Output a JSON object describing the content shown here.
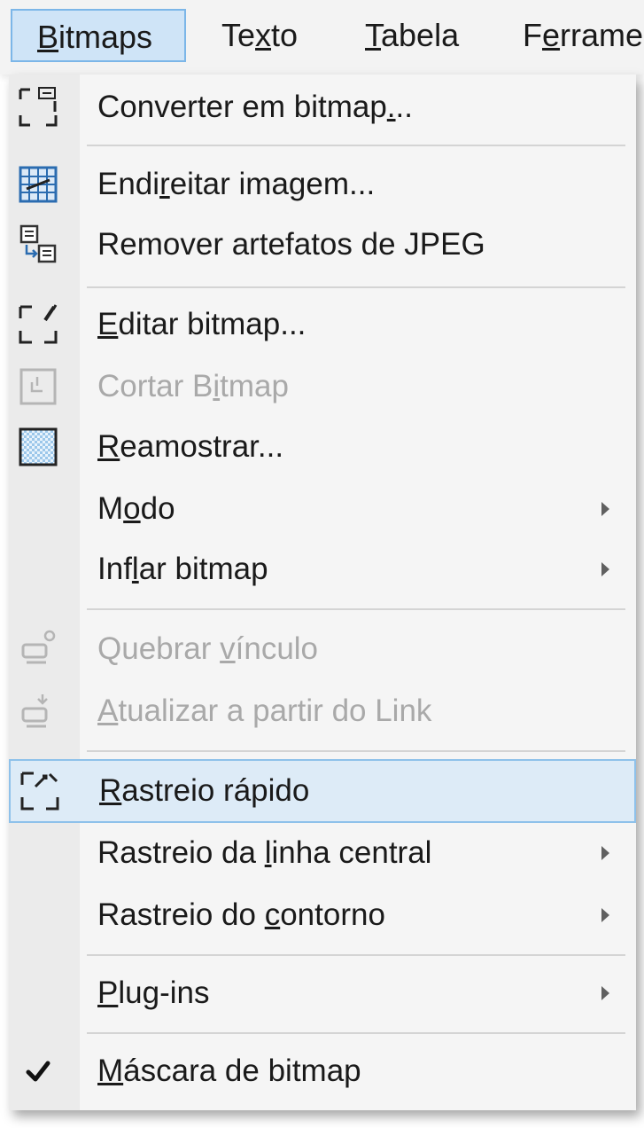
{
  "menubar": {
    "items": [
      {
        "pre": "",
        "key": "B",
        "post": "itmaps"
      },
      {
        "pre": "Te",
        "key": "x",
        "post": "to"
      },
      {
        "pre": "",
        "key": "T",
        "post": "abela"
      },
      {
        "pre": "F",
        "key": "e",
        "post": "rrame"
      }
    ]
  },
  "menu": {
    "items": [
      {
        "pre": "Converter em bitmap",
        "key": ".",
        "post": ".."
      },
      {
        "pre": "Endi",
        "key": "r",
        "post": "eitar imagem..."
      },
      {
        "pre": "Remover artefatos de JPEG",
        "key": "",
        "post": ""
      },
      {
        "pre": "",
        "key": "E",
        "post": "ditar bitmap..."
      },
      {
        "pre": "Cortar B",
        "key": "i",
        "post": "tmap"
      },
      {
        "pre": "",
        "key": "R",
        "post": "eamostrar..."
      },
      {
        "pre": "M",
        "key": "o",
        "post": "do"
      },
      {
        "pre": "Inf",
        "key": "l",
        "post": "ar bitmap"
      },
      {
        "pre": "Quebrar ",
        "key": "v",
        "post": "ínculo"
      },
      {
        "pre": "",
        "key": "A",
        "post": "tualizar a partir do Link"
      },
      {
        "pre": "",
        "key": "R",
        "post": "astreio rápido"
      },
      {
        "pre": "Rastreio da ",
        "key": "l",
        "post": "inha central"
      },
      {
        "pre": "Rastreio do ",
        "key": "c",
        "post": "ontorno"
      },
      {
        "pre": "",
        "key": "P",
        "post": "lug-ins"
      },
      {
        "pre": "",
        "key": "M",
        "post": "áscara de bitmap"
      }
    ]
  },
  "colors": {
    "menubar_bg": "#f3f3f3",
    "menu_bg": "#f5f5f5",
    "highlight_bg": "#ddebf7",
    "highlight_border": "#8ec1ea",
    "disabled_text": "#a9a9a9"
  },
  "icons": {
    "converter": "convert-to-bitmap-icon",
    "endireitar": "straighten-image-icon",
    "remover_jpeg": "remove-jpeg-artifacts-icon",
    "editar": "edit-bitmap-icon",
    "cortar": "crop-bitmap-icon",
    "reamostrar": "resample-icon",
    "quebrar": "break-link-icon",
    "atualizar": "update-from-link-icon",
    "rastreio_rapido": "quick-trace-icon",
    "mascara": "checkmark-icon",
    "submenu": "submenu-arrow-icon"
  }
}
